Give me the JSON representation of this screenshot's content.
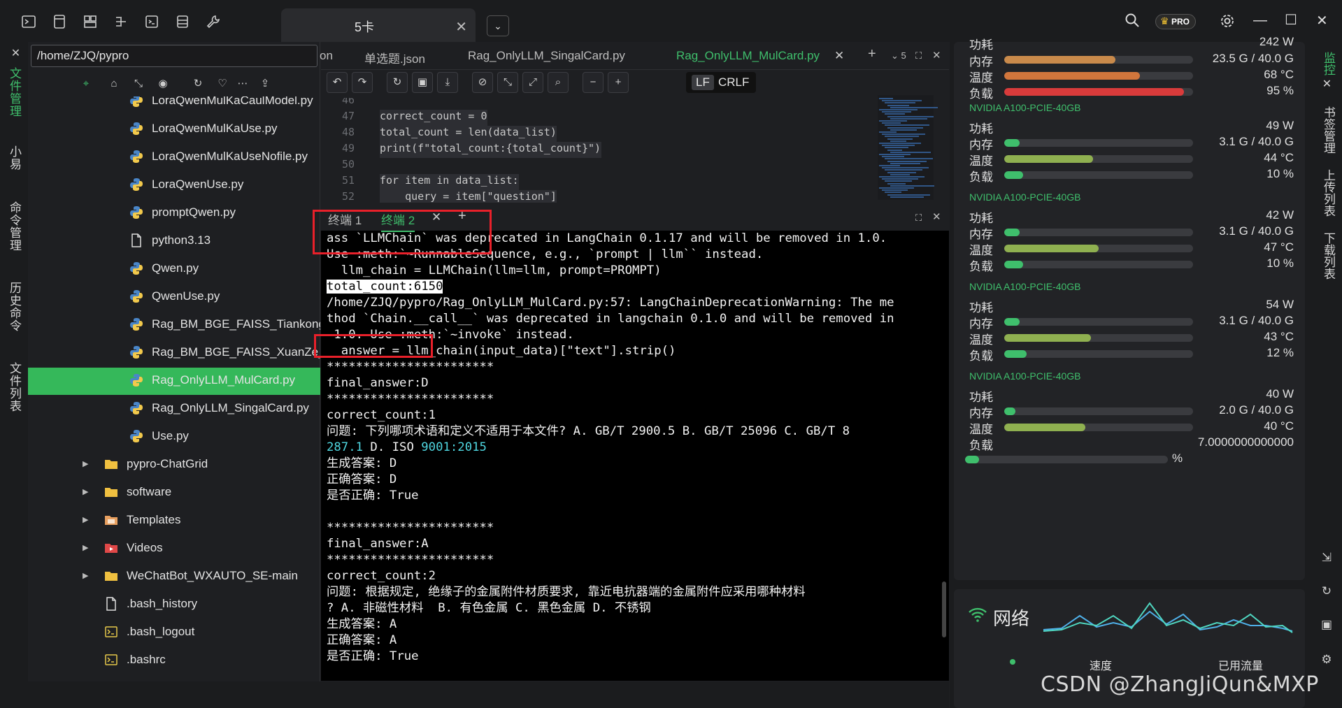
{
  "title_bar": {
    "tab_label": "5卡",
    "pro_label": "PRO"
  },
  "left_rail": {
    "tabs": [
      "文件管理",
      "小易",
      "命令管理",
      "历史命令",
      "文件列表"
    ]
  },
  "file_panel": {
    "path": "/home/ZJQ/pypro",
    "files": [
      {
        "name": "LoraQwenMulKaCaulModel.py",
        "type": "python",
        "expandable": false
      },
      {
        "name": "LoraQwenMulKaUse.py",
        "type": "python",
        "expandable": false
      },
      {
        "name": "LoraQwenMulKaUseNofile.py",
        "type": "python",
        "expandable": false
      },
      {
        "name": "LoraQwenUse.py",
        "type": "python",
        "expandable": false
      },
      {
        "name": "promptQwen.py",
        "type": "python",
        "expandable": false
      },
      {
        "name": "python3.13",
        "type": "file",
        "expandable": false
      },
      {
        "name": "Qwen.py",
        "type": "python",
        "expandable": false
      },
      {
        "name": "QwenUse.py",
        "type": "python",
        "expandable": false
      },
      {
        "name": "Rag_BM_BGE_FAISS_Tiankong",
        "type": "python",
        "expandable": false
      },
      {
        "name": "Rag_BM_BGE_FAISS_XuanZe_F",
        "type": "python",
        "expandable": false
      },
      {
        "name": "Rag_OnlyLLM_MulCard.py",
        "type": "python",
        "expandable": false,
        "selected": true
      },
      {
        "name": "Rag_OnlyLLM_SingalCard.py",
        "type": "python",
        "expandable": false
      },
      {
        "name": "Use.py",
        "type": "python",
        "expandable": false
      },
      {
        "name": "pypro-ChatGrid",
        "type": "folder",
        "expandable": true
      },
      {
        "name": "software",
        "type": "folder",
        "expandable": true
      },
      {
        "name": "Templates",
        "type": "folder-templates",
        "expandable": true
      },
      {
        "name": "Videos",
        "type": "folder-videos",
        "expandable": true
      },
      {
        "name": "WeChatBot_WXAUTO_SE-main",
        "type": "folder",
        "expandable": true
      },
      {
        "name": ".bash_history",
        "type": "file",
        "expandable": false
      },
      {
        "name": ".bash_logout",
        "type": "terminal",
        "expandable": false
      },
      {
        "name": ".bashrc",
        "type": "terminal",
        "expandable": false
      }
    ]
  },
  "editor": {
    "tabs": [
      {
        "label": "on",
        "active": false
      },
      {
        "label": "单选题.json",
        "active": false
      },
      {
        "label": "Rag_OnlyLLM_SingalCard.py",
        "active": false
      },
      {
        "label": "Rag_OnlyLLM_MulCard.py",
        "active": true
      }
    ],
    "tab_count": "5",
    "lf_label": "LF",
    "crlf_label": "CRLF",
    "lines": [
      {
        "num": "46",
        "text": ""
      },
      {
        "num": "47",
        "text": "correct_count = 0"
      },
      {
        "num": "48",
        "text": "total_count = len(data_list)"
      },
      {
        "num": "49",
        "text": "print(f\"total_count:{total_count}\")"
      },
      {
        "num": "50",
        "text": ""
      },
      {
        "num": "51",
        "text": "for item in data_list:"
      },
      {
        "num": "52",
        "text": "    query = item[\"question\"]"
      }
    ]
  },
  "terminal": {
    "tabs": [
      {
        "label": "终端 1",
        "active": false
      },
      {
        "label": "终端 2",
        "active": true
      }
    ],
    "lines": [
      "ass `LLMChain` was deprecated in LangChain 0.1.17 and will be removed in 1.0.",
      "Use :meth:`~RunnableSequence, e.g., `prompt | llm`` instead.",
      "  llm_chain = LLMChain(llm=llm, prompt=PROMPT)",
      "total_count:6150",
      "/home/ZJQ/pypro/Rag_OnlyLLM_MulCard.py:57: LangChainDeprecationWarning: The me",
      "thod `Chain.__call__` was deprecated in langchain 0.1.0 and will be removed in",
      " 1.0. Use :meth:`~invoke` instead.",
      "  answer = llm_chain(input_data)[\"text\"].strip()",
      "***********************",
      "final_answer:D",
      "***********************",
      "correct_count:1",
      "问题: 下列哪项术语和定义不适用于本文件? A. GB/T 2900.5 B. GB/T 25096 C. GB/T 8",
      "287.1 D. ISO 9001:2015",
      "生成答案: D",
      "正确答案: D",
      "是否正确: True",
      "",
      "***********************",
      "final_answer:A",
      "***********************",
      "correct_count:2",
      "问题: 根据规定, 绝缘子的金属附件材质要求, 靠近电抗器端的金属附件应采用哪种材料",
      "? A. 非磁性材料  B. 有色金属 C. 黑色金属 D. 不锈钢",
      "生成答案: A",
      "正确答案: A",
      "是否正确: True"
    ]
  },
  "monitor": {
    "top_row": {
      "label": "功耗",
      "value": "242 W"
    },
    "first_gpu": [
      {
        "label": "内存",
        "value": "23.5 G / 40.0 G",
        "level": 0.59,
        "color": "#c98a4b"
      },
      {
        "label": "温度",
        "value": "68 °C",
        "level": 0.72,
        "color": "#d2763c"
      },
      {
        "label": "负载",
        "value": "95 %",
        "level": 0.95,
        "color": "#d93b3b"
      }
    ],
    "gpus": [
      {
        "name": "NVIDIA A100-PCIE-40GB",
        "power": "49 W",
        "memory": {
          "value": "3.1 G / 40.0 G",
          "level": 0.08
        },
        "temp": {
          "value": "44 °C",
          "level": 0.47
        },
        "load": {
          "value": "10 %",
          "level": 0.1
        }
      },
      {
        "name": "NVIDIA A100-PCIE-40GB",
        "power": "42 W",
        "memory": {
          "value": "3.1 G / 40.0 G",
          "level": 0.08
        },
        "temp": {
          "value": "47 °C",
          "level": 0.5
        },
        "load": {
          "value": "10 %",
          "level": 0.1
        }
      },
      {
        "name": "NVIDIA A100-PCIE-40GB",
        "power": "54 W",
        "memory": {
          "value": "3.1 G / 40.0 G",
          "level": 0.08
        },
        "temp": {
          "value": "43 °C",
          "level": 0.46
        },
        "load": {
          "value": "12 %",
          "level": 0.12
        }
      },
      {
        "name": "NVIDIA A100-PCIE-40GB",
        "power": "40 W",
        "memory": {
          "value": "2.0 G / 40.0 G",
          "level": 0.05
        },
        "temp": {
          "value": "40 °C",
          "level": 0.43
        },
        "load": {
          "value": "7.0000000000000",
          "level": 0.07,
          "unit": "%"
        }
      }
    ],
    "labels": {
      "power": "功耗",
      "memory": "内存",
      "temp": "温度",
      "load": "负载"
    },
    "network": {
      "title": "网络",
      "speed_label": "速度",
      "traffic_label": "已用流量"
    }
  },
  "right_rail": {
    "tabs": [
      "监控",
      "书签管理",
      "上传列表",
      "下载列表"
    ]
  },
  "watermark": "CSDN @ZhangJiQun&MXP",
  "colors": {
    "accent": "#3fbf6c",
    "selected_row": "#35b85a",
    "highlight_box": "#e8202a",
    "cyan": "#4fd6e0"
  }
}
